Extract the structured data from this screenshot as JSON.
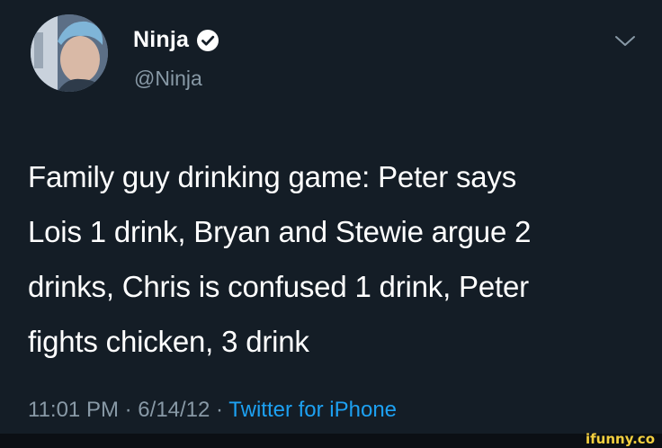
{
  "user": {
    "display_name": "Ninja",
    "handle": "@Ninja",
    "verified_icon": "verified-badge-icon",
    "avatar_icon": "profile-avatar"
  },
  "menu": {
    "icon": "chevron-down-icon"
  },
  "tweet": {
    "lines": [
      "Family guy drinking game: Peter says",
      "Lois 1 drink, Bryan and Stewie argue 2",
      "drinks, Chris is confused 1 drink, Peter",
      "fights chicken, 3 drink"
    ],
    "time": "11:01 PM",
    "date": "6/14/12",
    "separator": "·",
    "source": "Twitter for iPhone"
  },
  "watermark": {
    "text": "ifunny.co"
  },
  "colors": {
    "background": "#141d26",
    "text": "#ffffff",
    "secondary": "#8899a6",
    "link": "#1da1f2",
    "watermark": "#f4d03f"
  }
}
